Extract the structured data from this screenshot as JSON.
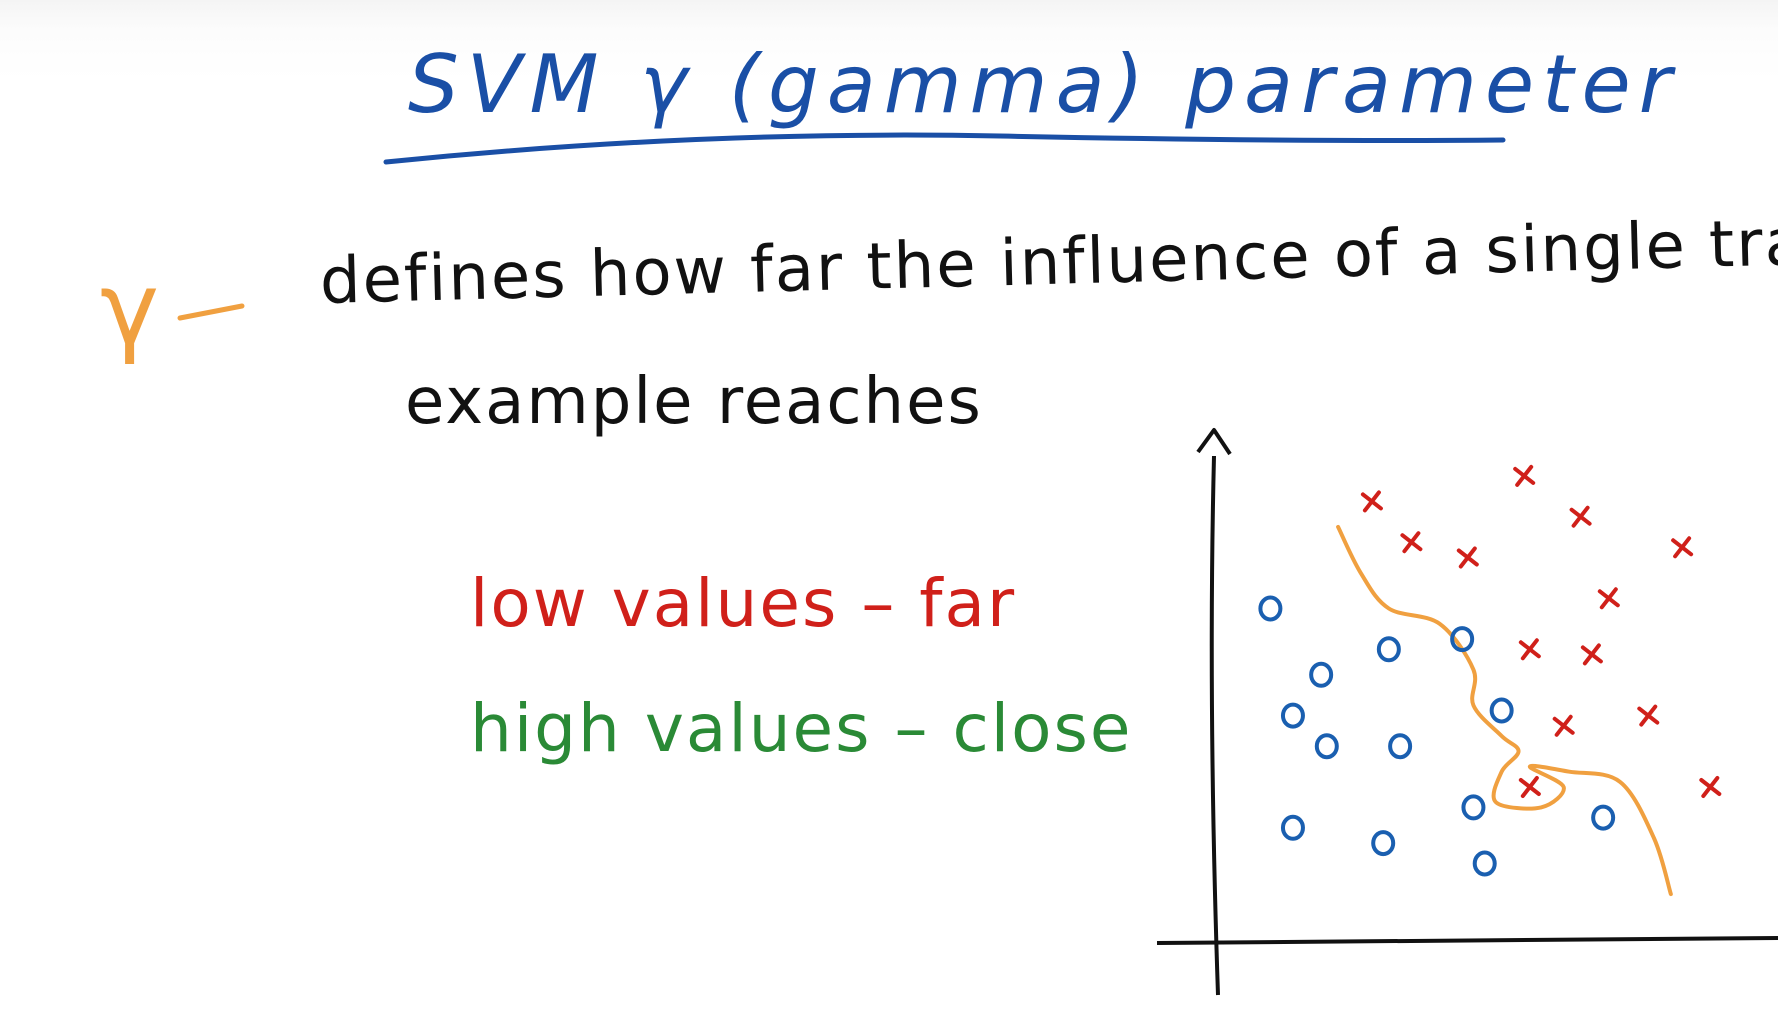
{
  "title": "SVM γ (gamma) parameter",
  "gamma_symbol": "γ",
  "definition": {
    "line1": "defines how far the influence of a single training",
    "line2": "example reaches"
  },
  "low_values": "low values – far",
  "high_values": "high values – close",
  "colors": {
    "title": "#1a4fa6",
    "accent": "#f0a040",
    "low": "#d0201a",
    "high": "#2a8a36",
    "circle_class": "#1a5fb0",
    "cross_class": "#d0201a",
    "axes": "#111111"
  },
  "chart_data": {
    "type": "scatter",
    "title": "",
    "xlabel": "",
    "ylabel": "",
    "xlim": [
      0,
      10
    ],
    "ylim": [
      0,
      10
    ],
    "grid": false,
    "series": [
      {
        "marker": "o",
        "points": [
          [
            1.0,
            6.5
          ],
          [
            1.4,
            2.2
          ],
          [
            1.4,
            4.4
          ],
          [
            2.0,
            3.8
          ],
          [
            1.9,
            5.2
          ],
          [
            3.3,
            3.8
          ],
          [
            3.1,
            5.7
          ],
          [
            3.0,
            1.9
          ],
          [
            4.4,
            5.9
          ],
          [
            4.6,
            2.6
          ],
          [
            4.8,
            1.5
          ],
          [
            5.1,
            4.5
          ],
          [
            6.9,
            2.4
          ]
        ]
      },
      {
        "marker": "x",
        "points": [
          [
            2.8,
            8.6
          ],
          [
            3.5,
            7.8
          ],
          [
            4.5,
            7.5
          ],
          [
            5.5,
            9.1
          ],
          [
            6.5,
            8.3
          ],
          [
            8.3,
            7.7
          ],
          [
            7.0,
            6.7
          ],
          [
            5.6,
            5.7
          ],
          [
            6.7,
            5.6
          ],
          [
            6.2,
            4.2
          ],
          [
            7.7,
            4.4
          ],
          [
            5.6,
            3.0
          ],
          [
            8.8,
            3.0
          ]
        ]
      }
    ],
    "boundary": [
      [
        2.2,
        8.1
      ],
      [
        2.6,
        7.2
      ],
      [
        3.1,
        6.5
      ],
      [
        4.0,
        6.2
      ],
      [
        4.6,
        5.3
      ],
      [
        4.6,
        4.6
      ],
      [
        5.1,
        4.0
      ],
      [
        5.4,
        3.7
      ],
      [
        5.1,
        3.3
      ],
      [
        5.0,
        2.7
      ],
      [
        5.8,
        2.6
      ],
      [
        6.2,
        3.0
      ],
      [
        5.6,
        3.4
      ],
      [
        6.3,
        3.3
      ],
      [
        7.2,
        3.1
      ],
      [
        7.8,
        2.0
      ],
      [
        8.1,
        0.9
      ]
    ]
  }
}
